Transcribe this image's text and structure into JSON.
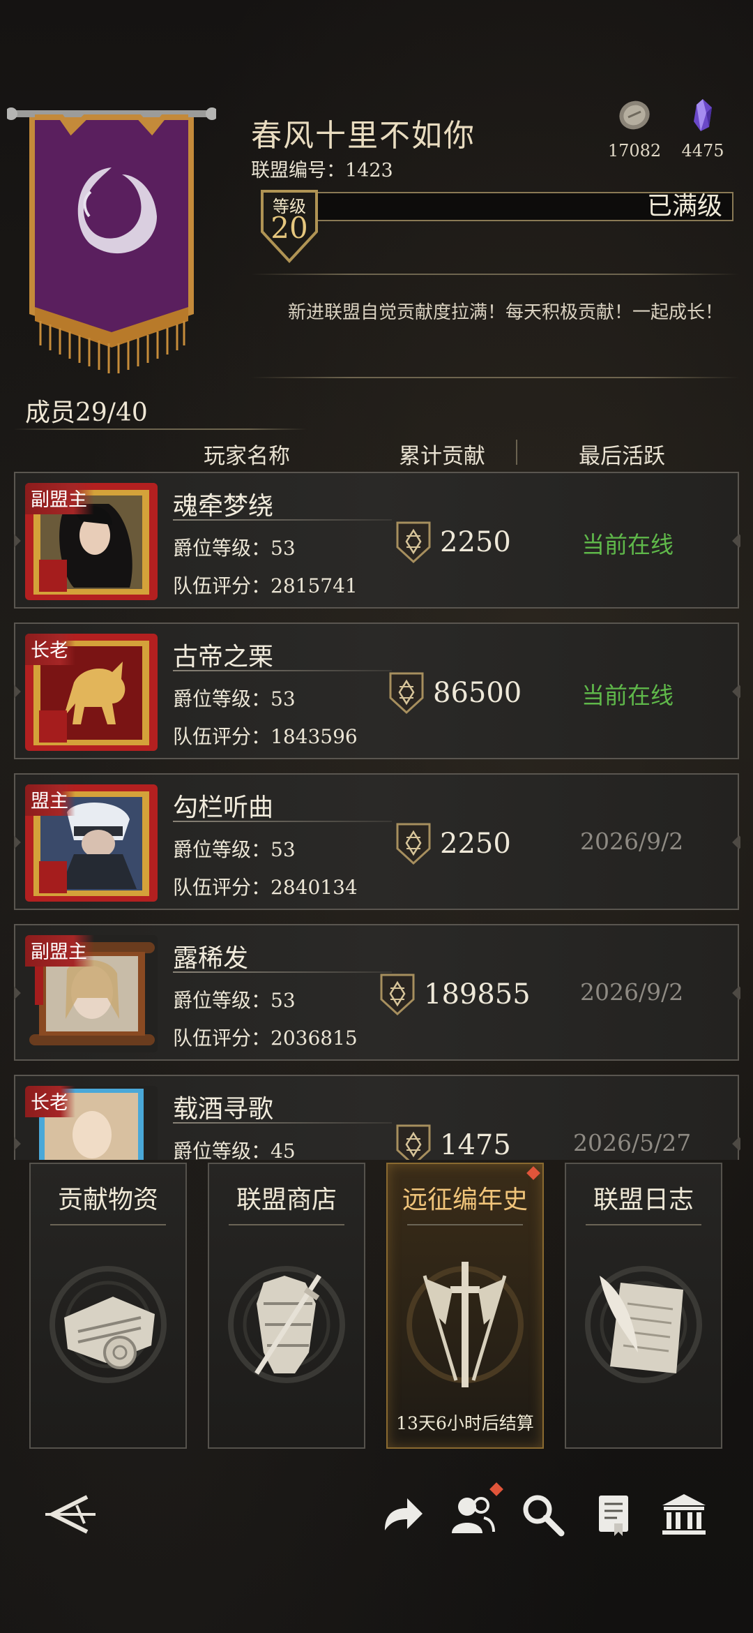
{
  "guild": {
    "name": "春风十里不如你",
    "id_label": "联盟编号：1423",
    "level_label": "等级",
    "level": "20",
    "level_status": "已满级",
    "motto": "新进联盟自觉贡献度拉满！每天积极贡献！一起成长！"
  },
  "currencies": [
    {
      "icon": "silver-coin-icon",
      "value": "17082"
    },
    {
      "icon": "purple-gem-icon",
      "value": "4475"
    }
  ],
  "members_label": "成员29/40",
  "columns": {
    "name": "玩家名称",
    "contribution": "累计贡献",
    "last_active": "最后活跃"
  },
  "rows": [
    {
      "role": "副盟主",
      "name": "魂牵梦绕",
      "rank": "爵位等级：53",
      "score": "队伍评分：2815741",
      "contribution": "2250",
      "last_active": "当前在线",
      "online": true
    },
    {
      "role": "长老",
      "name": "古帝之栗",
      "rank": "爵位等级：53",
      "score": "队伍评分：1843596",
      "contribution": "86500",
      "last_active": "当前在线",
      "online": true
    },
    {
      "role": "盟主",
      "name": "勾栏听曲",
      "rank": "爵位等级：53",
      "score": "队伍评分：2840134",
      "contribution": "2250",
      "last_active": "2026/9/2",
      "online": false
    },
    {
      "role": "副盟主",
      "name": "露稀发",
      "rank": "爵位等级：53",
      "score": "队伍评分：2036815",
      "contribution": "189855",
      "last_active": "2026/9/2",
      "online": false
    },
    {
      "role": "长老",
      "name": "载酒寻歌",
      "rank": "爵位等级：45",
      "score": "",
      "contribution": "1475",
      "last_active": "2026/5/27",
      "online": false
    }
  ],
  "cards": [
    {
      "title": "贡献物资",
      "icon": "scroll-bundle-icon",
      "footer": ""
    },
    {
      "title": "联盟商店",
      "icon": "armor-sword-icon",
      "footer": ""
    },
    {
      "title": "远征编年史",
      "icon": "crossed-banners-sword-icon",
      "footer": "13天6小时后结算"
    },
    {
      "title": "联盟日志",
      "icon": "quill-parchment-icon",
      "footer": ""
    }
  ],
  "nav": [
    "back-arrow-icon",
    "share-icon",
    "members-icon",
    "search-icon",
    "records-icon",
    "hall-icon"
  ]
}
